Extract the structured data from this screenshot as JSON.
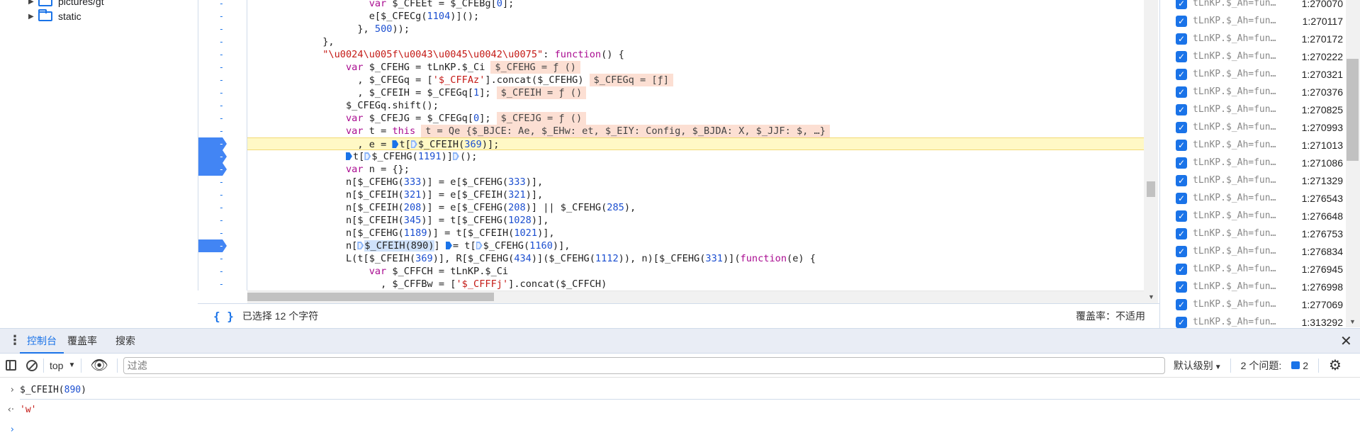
{
  "file_tree": [
    {
      "label": "pictures/gt",
      "expanded": false
    },
    {
      "label": "static",
      "expanded": false
    }
  ],
  "code": {
    "breakpoint_lines": [
      11,
      12,
      13,
      19
    ],
    "current_line": 11,
    "gutter_label": "-",
    "lines": [
      {
        "indent": 20,
        "tokens": [
          [
            "k",
            "var"
          ],
          [
            "p",
            " $_CFEEt = $_CFEBg["
          ],
          [
            "n",
            "0"
          ],
          [
            "p",
            "];"
          ]
        ]
      },
      {
        "indent": 20,
        "tokens": [
          [
            "p",
            "e[$_CFECg("
          ],
          [
            "n",
            "1104"
          ],
          [
            "p",
            ")]();"
          ]
        ]
      },
      {
        "indent": 18,
        "tokens": [
          [
            "p",
            "}, "
          ],
          [
            "n",
            "500"
          ],
          [
            "p",
            "));"
          ]
        ]
      },
      {
        "indent": 12,
        "tokens": [
          [
            "p",
            "},"
          ]
        ]
      },
      {
        "indent": 12,
        "tokens": [
          [
            "s",
            "\"\\u0024\\u005f\\u0043\\u0045\\u0042\\u0075\""
          ],
          [
            "p",
            ": "
          ],
          [
            "k",
            "function"
          ],
          [
            "p",
            "() {"
          ]
        ]
      },
      {
        "indent": 16,
        "tokens": [
          [
            "k",
            "var"
          ],
          [
            "p",
            " $_CFEHG = tLnKP.$_Ci"
          ],
          [
            "chip",
            "$_CFEHG = ƒ ()"
          ]
        ]
      },
      {
        "indent": 18,
        "tokens": [
          [
            "p",
            ", $_CFEGq = ["
          ],
          [
            "s",
            "'$_CFFAz'"
          ],
          [
            "p",
            "].concat($_CFEHG)"
          ],
          [
            "chip",
            "$_CFEGq = [ƒ]"
          ]
        ]
      },
      {
        "indent": 18,
        "tokens": [
          [
            "p",
            ", $_CFEIH = $_CFEGq["
          ],
          [
            "n",
            "1"
          ],
          [
            "p",
            "];"
          ],
          [
            "chip",
            "$_CFEIH = ƒ ()"
          ]
        ]
      },
      {
        "indent": 16,
        "tokens": [
          [
            "p",
            "$_CFEGq.shift();"
          ]
        ]
      },
      {
        "indent": 16,
        "tokens": [
          [
            "k",
            "var"
          ],
          [
            "p",
            " $_CFEJG = $_CFEGq["
          ],
          [
            "n",
            "0"
          ],
          [
            "p",
            "];"
          ],
          [
            "chip",
            "$_CFEJG = ƒ ()"
          ]
        ]
      },
      {
        "indent": 16,
        "tokens": [
          [
            "k",
            "var"
          ],
          [
            "p",
            " t = "
          ],
          [
            "k",
            "this"
          ],
          [
            "chip",
            "t = Qe {$_BJCE: Ae, $_EHw: et, $_EIY: Config, $_BJDA: X, $_JJF: $, …}"
          ]
        ]
      },
      {
        "indent": 18,
        "tokens": [
          [
            "p",
            ", e = "
          ],
          [
            "bm",
            ""
          ],
          [
            "p",
            "t["
          ],
          [
            "bh",
            ""
          ],
          [
            "p",
            "$_CFEIH("
          ],
          [
            "n",
            "369"
          ],
          [
            "p",
            ")];"
          ]
        ]
      },
      {
        "indent": 16,
        "tokens": [
          [
            "bm",
            ""
          ],
          [
            "p",
            "t["
          ],
          [
            "bh",
            ""
          ],
          [
            "p",
            "$_CFEHG("
          ],
          [
            "n",
            "1191"
          ],
          [
            "p",
            ")]"
          ],
          [
            "bh",
            ""
          ],
          [
            "p",
            "();"
          ]
        ]
      },
      {
        "indent": 16,
        "tokens": [
          [
            "k",
            "var"
          ],
          [
            "p",
            " n = {};"
          ]
        ]
      },
      {
        "indent": 16,
        "tokens": [
          [
            "p",
            "n[$_CFEHG("
          ],
          [
            "n",
            "333"
          ],
          [
            "p",
            ")] = e[$_CFEHG("
          ],
          [
            "n",
            "333"
          ],
          [
            "p",
            ")],"
          ]
        ]
      },
      {
        "indent": 16,
        "tokens": [
          [
            "p",
            "n[$_CFEIH("
          ],
          [
            "n",
            "321"
          ],
          [
            "p",
            ")] = e[$_CFEIH("
          ],
          [
            "n",
            "321"
          ],
          [
            "p",
            ")],"
          ]
        ]
      },
      {
        "indent": 16,
        "tokens": [
          [
            "p",
            "n[$_CFEIH("
          ],
          [
            "n",
            "208"
          ],
          [
            "p",
            ")] = e[$_CFEHG("
          ],
          [
            "n",
            "208"
          ],
          [
            "p",
            ")] || $_CFEHG("
          ],
          [
            "n",
            "285"
          ],
          [
            "p",
            "),"
          ]
        ]
      },
      {
        "indent": 16,
        "tokens": [
          [
            "p",
            "n[$_CFEIH("
          ],
          [
            "n",
            "345"
          ],
          [
            "p",
            ")] = t[$_CFEHG("
          ],
          [
            "n",
            "1028"
          ],
          [
            "p",
            ")],"
          ]
        ]
      },
      {
        "indent": 16,
        "tokens": [
          [
            "p",
            "n[$_CFEHG("
          ],
          [
            "n",
            "1189"
          ],
          [
            "p",
            ")] = t[$_CFEIH("
          ],
          [
            "n",
            "1021"
          ],
          [
            "p",
            ")],"
          ]
        ]
      },
      {
        "indent": 16,
        "tokens": [
          [
            "p",
            "n["
          ],
          [
            "bh",
            ""
          ],
          [
            "sel",
            "$_CFEIH(890)"
          ],
          [
            "p",
            "] "
          ],
          [
            "bm",
            ""
          ],
          [
            "p",
            "= t["
          ],
          [
            "bh",
            ""
          ],
          [
            "p",
            "$_CFEHG("
          ],
          [
            "n",
            "1160"
          ],
          [
            "p",
            ")],"
          ]
        ]
      },
      {
        "indent": 16,
        "tokens": [
          [
            "p",
            "L(t[$_CFEIH("
          ],
          [
            "n",
            "369"
          ],
          [
            "p",
            ")], R[$_CFEHG("
          ],
          [
            "n",
            "434"
          ],
          [
            "p",
            ")]($_CFEHG("
          ],
          [
            "n",
            "1112"
          ],
          [
            "p",
            ")), n)[$_CFEHG("
          ],
          [
            "n",
            "331"
          ],
          [
            "p",
            ")]("
          ],
          [
            "k",
            "function"
          ],
          [
            "p",
            "(e) {"
          ]
        ]
      },
      {
        "indent": 20,
        "tokens": [
          [
            "k",
            "var"
          ],
          [
            "p",
            " $_CFFCH = tLnKP.$_Ci"
          ]
        ]
      },
      {
        "indent": 22,
        "tokens": [
          [
            "p",
            ", $_CFFBw = ["
          ],
          [
            "s",
            "'$_CFFFj'"
          ],
          [
            "p",
            "].concat($_CFFCH)"
          ]
        ]
      }
    ]
  },
  "status_bar": {
    "pretty_print_icon": "{ }",
    "selection": "已选择 12 个字符",
    "coverage": "覆盖率：不适用"
  },
  "breakpoints": [
    {
      "label": "tLnKP.$_Ah=fun…",
      "location": "1:270070",
      "checked": true
    },
    {
      "label": "tLnKP.$_Ah=fun…",
      "location": "1:270117",
      "checked": true
    },
    {
      "label": "tLnKP.$_Ah=fun…",
      "location": "1:270172",
      "checked": true
    },
    {
      "label": "tLnKP.$_Ah=fun…",
      "location": "1:270222",
      "checked": true
    },
    {
      "label": "tLnKP.$_Ah=fun…",
      "location": "1:270321",
      "checked": true
    },
    {
      "label": "tLnKP.$_Ah=fun…",
      "location": "1:270376",
      "checked": true
    },
    {
      "label": "tLnKP.$_Ah=fun…",
      "location": "1:270825",
      "checked": true
    },
    {
      "label": "tLnKP.$_Ah=fun…",
      "location": "1:270993",
      "checked": true
    },
    {
      "label": "tLnKP.$_Ah=fun…",
      "location": "1:271013",
      "checked": true
    },
    {
      "label": "tLnKP.$_Ah=fun…",
      "location": "1:271086",
      "checked": true
    },
    {
      "label": "tLnKP.$_Ah=fun…",
      "location": "1:271329",
      "checked": true
    },
    {
      "label": "tLnKP.$_Ah=fun…",
      "location": "1:276543",
      "checked": true
    },
    {
      "label": "tLnKP.$_Ah=fun…",
      "location": "1:276648",
      "checked": true
    },
    {
      "label": "tLnKP.$_Ah=fun…",
      "location": "1:276753",
      "checked": true
    },
    {
      "label": "tLnKP.$_Ah=fun…",
      "location": "1:276834",
      "checked": true
    },
    {
      "label": "tLnKP.$_Ah=fun…",
      "location": "1:276945",
      "checked": true
    },
    {
      "label": "tLnKP.$_Ah=fun…",
      "location": "1:276998",
      "checked": true
    },
    {
      "label": "tLnKP.$_Ah=fun…",
      "location": "1:277069",
      "checked": true
    },
    {
      "label": "tLnKP.$_Ah=fun…",
      "location": "1:313292",
      "checked": true
    }
  ],
  "drawer": {
    "tabs": [
      {
        "label": "控制台",
        "active": true
      },
      {
        "label": "覆盖率",
        "active": false
      },
      {
        "label": "搜索",
        "active": false
      }
    ]
  },
  "console_toolbar": {
    "context": "top",
    "filter_placeholder": "过滤",
    "level": "默认级别",
    "issues_label": "2 个问题:",
    "issues_count": "2"
  },
  "console": {
    "input": "$_CFEIH(890)",
    "input_arg": "890",
    "input_fn": "$_CFEIH(",
    "input_close": ")",
    "result": "'w'"
  },
  "colors": {
    "accent": "#1a73e8",
    "keyword": "#aa0d91",
    "string": "#c41a16",
    "number": "#1c4fd0",
    "inline_value_bg": "#fcdfd3",
    "current_line_bg": "#fff8c5"
  }
}
